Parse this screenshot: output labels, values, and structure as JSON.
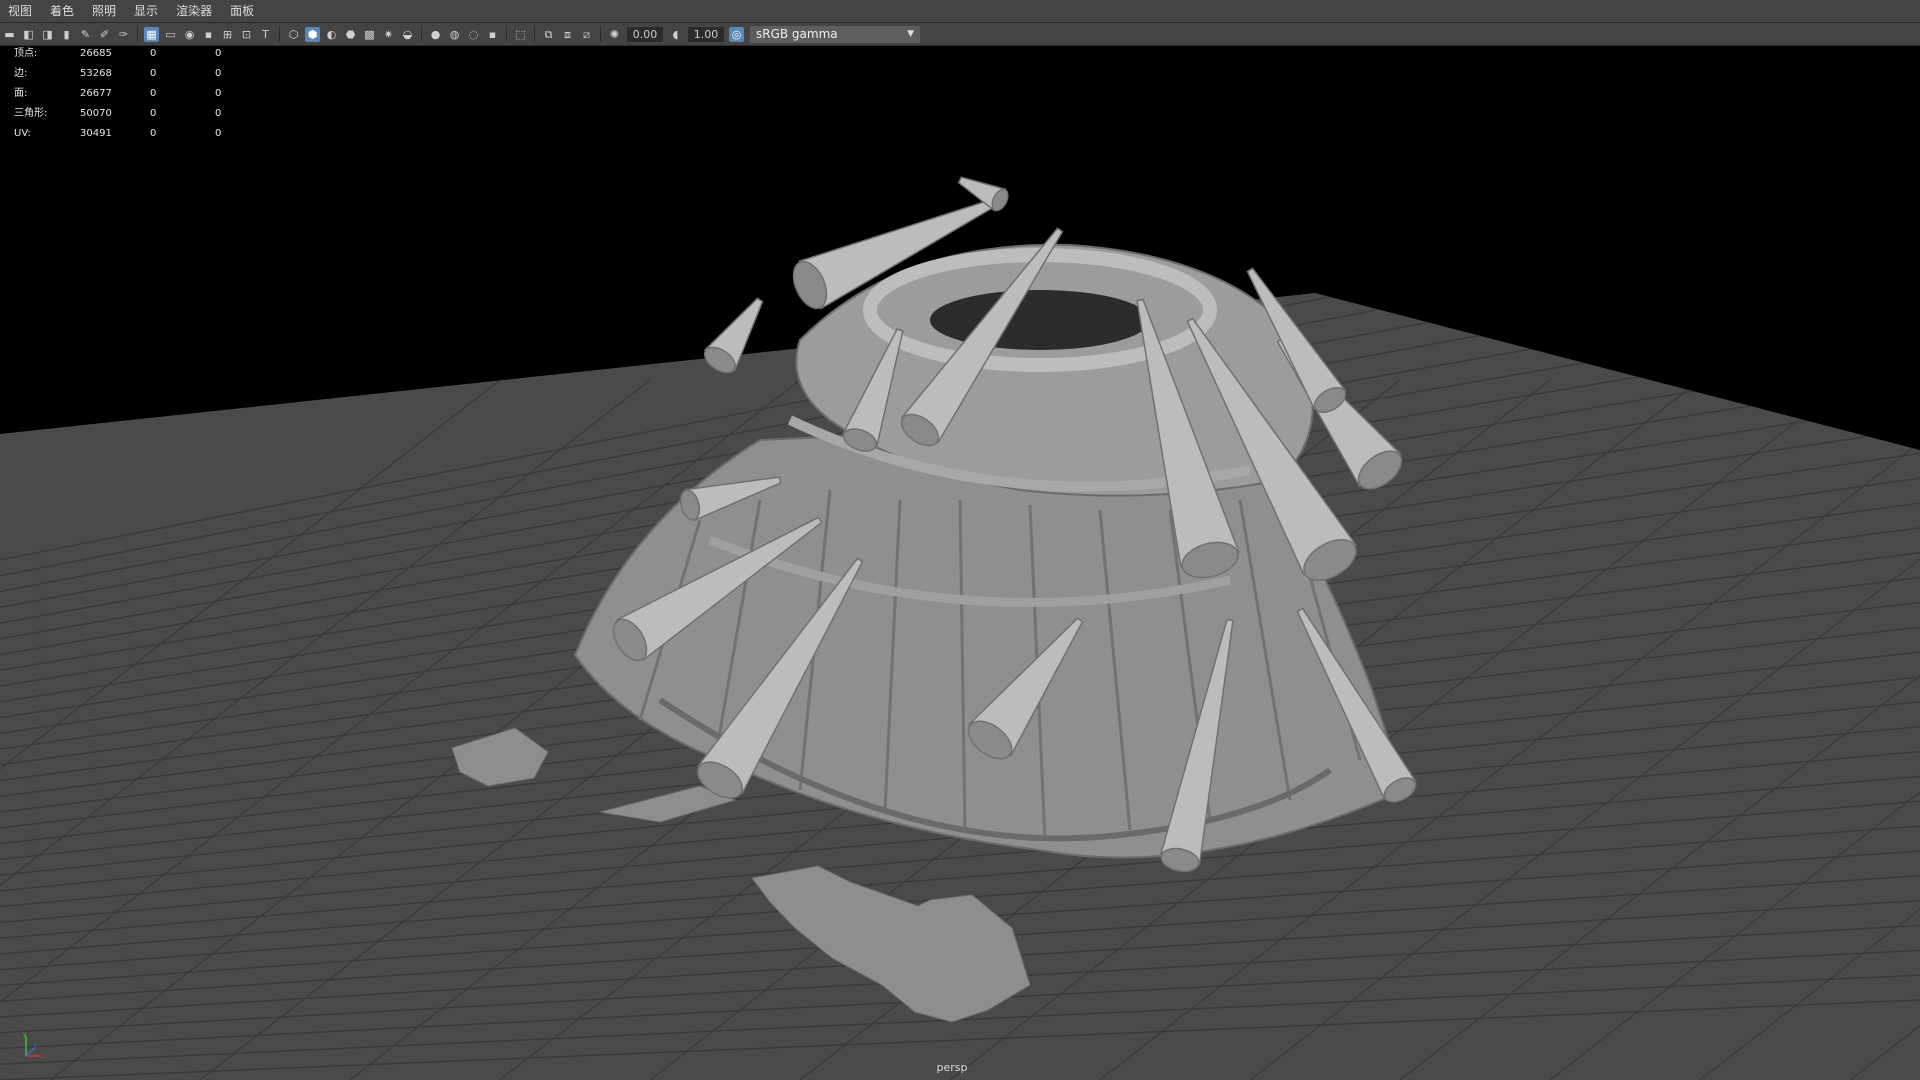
{
  "menu": {
    "items": [
      {
        "label": "视图"
      },
      {
        "label": "着色"
      },
      {
        "label": "照明"
      },
      {
        "label": "显示"
      },
      {
        "label": "渲染器"
      },
      {
        "label": "面板"
      }
    ]
  },
  "toolbar": {
    "exposure_value": "0.00",
    "gamma_value": "1.00",
    "color_space": "sRGB gamma"
  },
  "hud": {
    "rows": [
      {
        "label": "顶点:",
        "v1": "26685",
        "v2": "0",
        "v3": "0"
      },
      {
        "label": "边:",
        "v1": "53268",
        "v2": "0",
        "v3": "0"
      },
      {
        "label": "面:",
        "v1": "26677",
        "v2": "0",
        "v3": "0"
      },
      {
        "label": "三角形:",
        "v1": "50070",
        "v2": "0",
        "v3": "0"
      },
      {
        "label": "UV:",
        "v1": "30491",
        "v2": "0",
        "v3": "0"
      }
    ]
  },
  "viewport": {
    "camera": "persp",
    "background_color": "#000000",
    "ground_color": "#4a4a4a",
    "grid_color": "#3a3a3a",
    "model_color": "#9a9a9a"
  },
  "axis": {
    "x": "x",
    "y": "y",
    "z": "z"
  }
}
